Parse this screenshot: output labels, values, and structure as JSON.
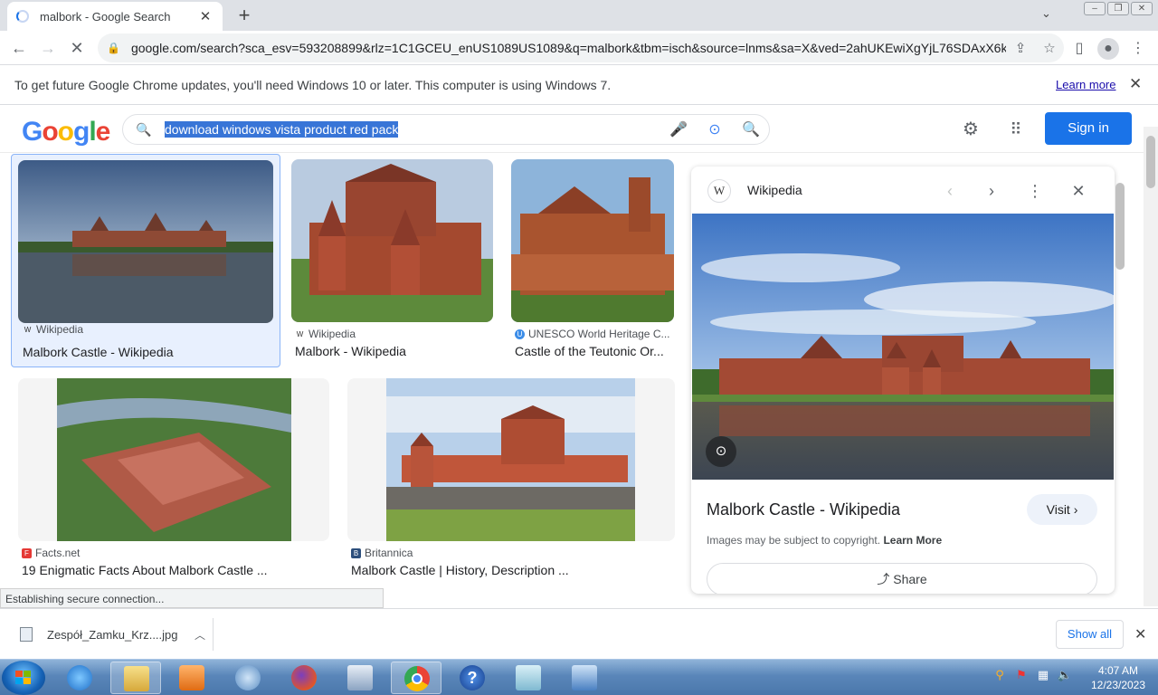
{
  "browser": {
    "tab_title": "malbork - Google Search",
    "url": "google.com/search?sca_esv=593208899&rlz=1C1GCEU_enUS1089US1089&q=malbork&tbm=isch&source=lnms&sa=X&ved=2ahUKEwiXgYjL76SDAxX6k...",
    "new_tab_glyph": "+",
    "close_glyph": "✕"
  },
  "infobar": {
    "message": "To get future Google Chrome updates, you'll need Windows 10 or later. This computer is using Windows 7.",
    "learn_more": "Learn more"
  },
  "google": {
    "logo_letters": [
      "G",
      "o",
      "o",
      "g",
      "l",
      "e"
    ],
    "query": "download windows vista product red pack",
    "sign_in": "Sign in"
  },
  "results": [
    {
      "source": "Wikipedia",
      "title": "Malbork Castle - Wikipedia",
      "favicon": "W",
      "favicon_color": "#ffffff",
      "selected": true
    },
    {
      "source": "Wikipedia",
      "title": "Malbork - Wikipedia",
      "favicon": "W",
      "favicon_color": "#ffffff",
      "selected": false
    },
    {
      "source": "UNESCO World Heritage C...",
      "title": "Castle of the Teutonic Or...",
      "favicon": "U",
      "favicon_color": "#3c8de8",
      "selected": false
    },
    {
      "source": "Facts.net",
      "title": "19 Enigmatic Facts About Malbork Castle ...",
      "favicon": "F",
      "favicon_color": "#e53935",
      "selected": false
    },
    {
      "source": "Britannica",
      "title": "Malbork Castle | History, Description ...",
      "favicon": "B",
      "favicon_color": "#2d4f7c",
      "selected": false
    }
  ],
  "panel": {
    "source_name": "Wikipedia",
    "source_logo": "W",
    "title": "Malbork Castle - Wikipedia",
    "visit": "Visit ›",
    "copyright_text": "Images may be subject to copyright.",
    "copyright_link": "Learn More",
    "share": "Share"
  },
  "status_text": "Establishing secure connection...",
  "downloads": {
    "file_name": "Zespół_Zamku_Krz....jpg",
    "show_all": "Show all"
  },
  "taskbar": {
    "time": "4:07 AM",
    "date": "12/23/2023"
  },
  "colors": {
    "accent": "#1a73e8",
    "link": "#1a0dab",
    "selection": "#3875d7"
  }
}
